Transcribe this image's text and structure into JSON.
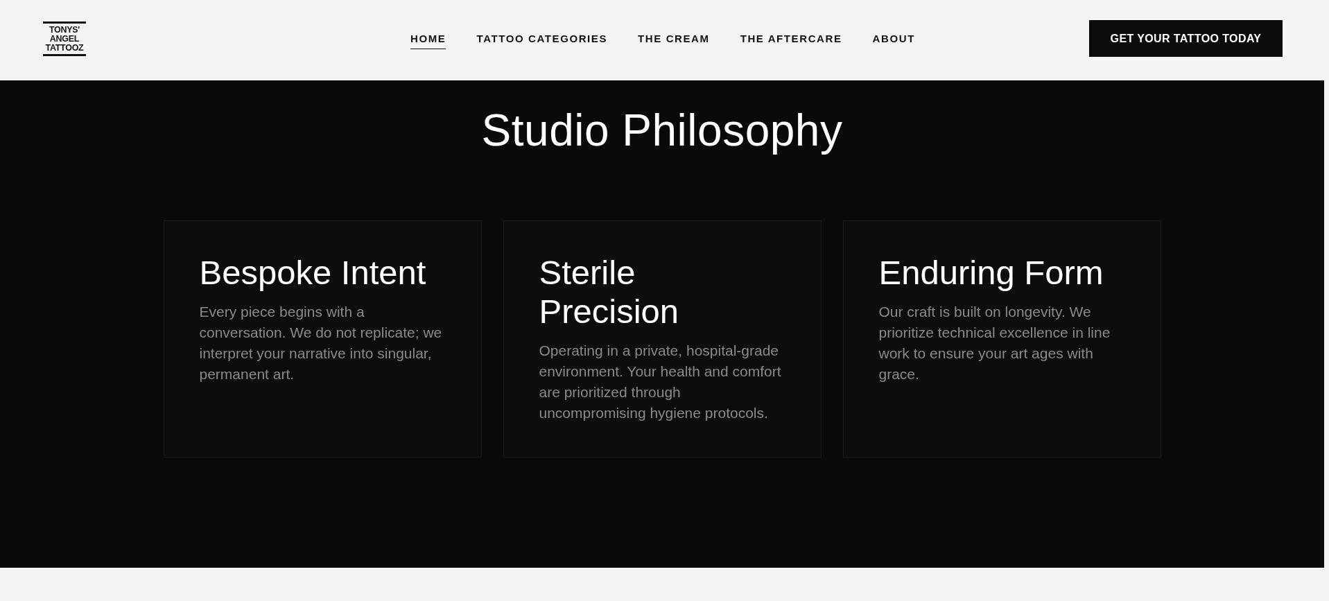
{
  "header": {
    "logo": {
      "lines": [
        "TONYS'",
        "ANGEL",
        "TATTOOZ"
      ]
    },
    "nav": [
      {
        "label": "HOME",
        "selected": true
      },
      {
        "label": "TATTOO CATEGORIES",
        "selected": false
      },
      {
        "label": "THE CREAM",
        "selected": false
      },
      {
        "label": "THE AFTERCARE",
        "selected": false
      },
      {
        "label": "ABOUT",
        "selected": false
      }
    ],
    "cta_button": "GET YOUR TATTOO TODAY"
  },
  "section": {
    "title": "Studio Philosophy",
    "cards": [
      {
        "title": "Bespoke Intent",
        "text": "Every piece begins with a conversation. We do not replicate; we interpret your narrative into singular, permanent art."
      },
      {
        "title": "Sterile Precision",
        "text": "Operating in a private, hospital-grade environment. Your health and comfort are prioritized through uncompromising hygiene protocols."
      },
      {
        "title": "Enduring Form",
        "text": "Our craft is built on longevity. We prioritize technical excellence in line work to ensure your art ages with grace."
      }
    ]
  }
}
